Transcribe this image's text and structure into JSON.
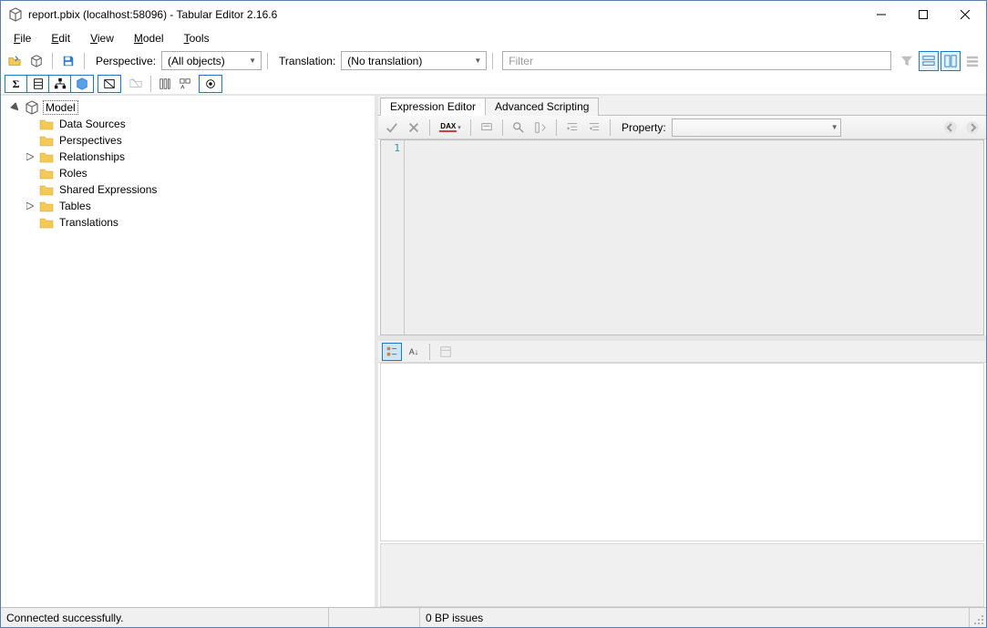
{
  "window": {
    "title": "report.pbix (localhost:58096) - Tabular Editor 2.16.6"
  },
  "menu": {
    "file": "File",
    "edit": "Edit",
    "view": "View",
    "model": "Model",
    "tools": "Tools"
  },
  "toolbar": {
    "perspective_label": "Perspective:",
    "perspective_value": "(All objects)",
    "translation_label": "Translation:",
    "translation_value": "(No translation)",
    "filter_placeholder": "Filter"
  },
  "tree": {
    "root": "Model",
    "items": [
      {
        "label": "Data Sources",
        "expandable": false
      },
      {
        "label": "Perspectives",
        "expandable": false
      },
      {
        "label": "Relationships",
        "expandable": true
      },
      {
        "label": "Roles",
        "expandable": false
      },
      {
        "label": "Shared Expressions",
        "expandable": false
      },
      {
        "label": "Tables",
        "expandable": true
      },
      {
        "label": "Translations",
        "expandable": false
      }
    ]
  },
  "tabs": {
    "expression": "Expression Editor",
    "scripting": "Advanced Scripting"
  },
  "editor": {
    "property_label": "Property:",
    "line_number": "1",
    "dax_label": "DAX"
  },
  "status": {
    "connected": "Connected successfully.",
    "bp": "0 BP issues"
  }
}
